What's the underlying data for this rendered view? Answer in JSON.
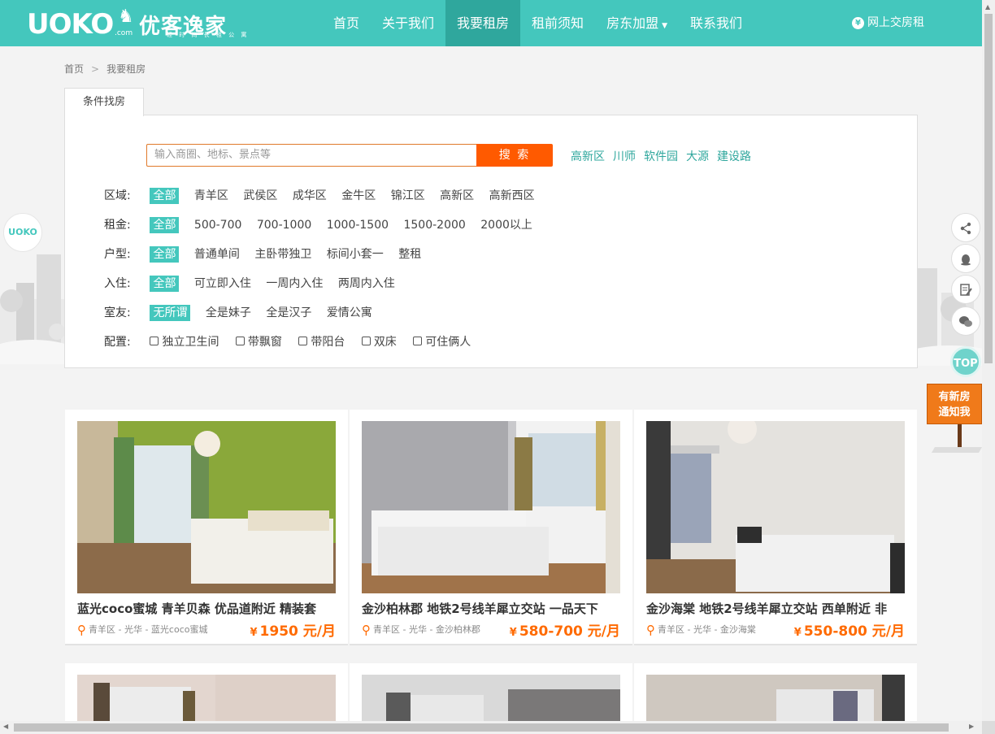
{
  "header": {
    "logo_text": "UOKO",
    "logo_com": ".com",
    "logo_cn": "优客逸家",
    "logo_sub": "轻 时 尚 长 租 公 寓",
    "nav": [
      {
        "label": "首页"
      },
      {
        "label": "关于我们"
      },
      {
        "label": "我要租房",
        "active": true
      },
      {
        "label": "租前须知"
      },
      {
        "label": "房东加盟",
        "dropdown": true
      },
      {
        "label": "联系我们"
      }
    ],
    "pay_label": "网上交房租",
    "pay_icon": "yen-icon"
  },
  "breadcrumb": {
    "home": "首页",
    "sep": ">",
    "current": "我要租房"
  },
  "filter": {
    "tab_label": "条件找房",
    "search_placeholder": "输入商圈、地标、景点等",
    "search_button": "搜 索",
    "hot_areas": [
      "高新区",
      "川师",
      "软件园",
      "大源",
      "建设路"
    ],
    "rows": [
      {
        "label": "区域:",
        "options": [
          "全部",
          "青羊区",
          "武侯区",
          "成华区",
          "金牛区",
          "锦江区",
          "高新区",
          "高新西区"
        ]
      },
      {
        "label": "租金:",
        "options": [
          "全部",
          "500-700",
          "700-1000",
          "1000-1500",
          "1500-2000",
          "2000以上"
        ]
      },
      {
        "label": "户型:",
        "options": [
          "全部",
          "普通单间",
          "主卧带独卫",
          "标间小套一",
          "整租"
        ]
      },
      {
        "label": "入住:",
        "options": [
          "全部",
          "可立即入住",
          "一周内入住",
          "两周内入住"
        ]
      },
      {
        "label": "室友:",
        "options": [
          "无所谓",
          "全是妹子",
          "全是汉子",
          "爱情公寓"
        ]
      }
    ],
    "config_label": "配置:",
    "config_options": [
      "独立卫生间",
      "带飘窗",
      "带阳台",
      "双床",
      "可住俩人"
    ]
  },
  "side_logo": "UOKO",
  "floating": {
    "top_label": "TOP",
    "notify_line1": "有新房",
    "notify_line2": "通知我"
  },
  "listings": [
    {
      "title": "蓝光coco蜜城 青羊贝森 优品道附近 精装套",
      "location": "青羊区 - 光华 - 蓝光coco蜜城",
      "price_symbol": "¥",
      "price": "1950 元/月",
      "wall": "#8aa83a"
    },
    {
      "title": "金沙柏林郡 地铁2号线羊犀立交站 一品天下",
      "location": "青羊区 - 光华 - 金沙柏林郡",
      "price_symbol": "¥",
      "price": "580-700 元/月",
      "wall": "#c9c9cc"
    },
    {
      "title": "金沙海棠 地铁2号线羊犀立交站 西单附近 非",
      "location": "青羊区 - 光华 - 金沙海棠",
      "price_symbol": "¥",
      "price": "550-800 元/月",
      "wall": "#d8d6d2"
    },
    {
      "title": "",
      "location": "",
      "price_symbol": "",
      "price": "",
      "wall": "#e3d6cf"
    },
    {
      "title": "",
      "location": "",
      "price_symbol": "",
      "price": "",
      "wall": "#9c9a9a"
    },
    {
      "title": "",
      "location": "",
      "price_symbol": "",
      "price": "",
      "wall": "#cfc8c0"
    }
  ]
}
